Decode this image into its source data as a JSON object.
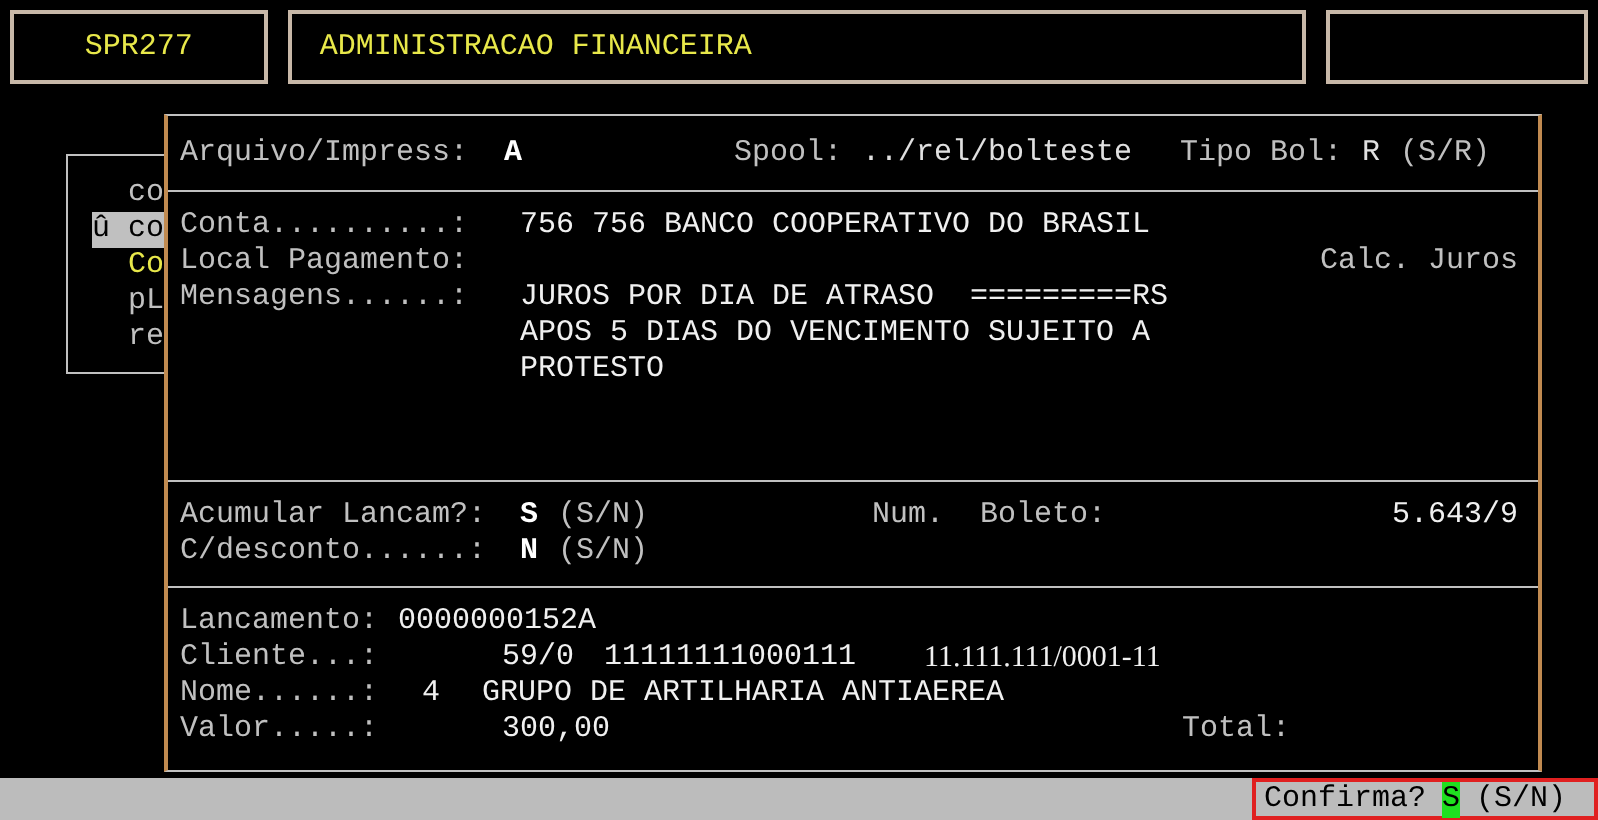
{
  "header": {
    "program_code": "SPR277",
    "module_title": "ADMINISTRACAO FINANCEIRA"
  },
  "background_menu": [
    {
      "text": "co",
      "selected": false,
      "highlighted": false
    },
    {
      "text": "û co",
      "selected": true,
      "highlighted": false
    },
    {
      "text": "Co",
      "selected": false,
      "highlighted": true
    },
    {
      "text": "pL",
      "selected": false,
      "highlighted": false
    },
    {
      "text": "re",
      "selected": false,
      "highlighted": false
    }
  ],
  "dialog": {
    "print_row": [
      {
        "label": "Arquivo/Impress:",
        "value": "A"
      },
      {
        "label": "Spool:",
        "value": "../rel/bolteste"
      },
      {
        "label": "Tipo Bol:",
        "value": "R",
        "hint": "(S/R)"
      }
    ],
    "account": {
      "label": "Conta..........:",
      "value": "756 756 BANCO COOPERATIVO DO BRASIL"
    },
    "payment_place": {
      "label": "Local Pagamento:",
      "side_label": "Calc. Juros"
    },
    "messages": {
      "label": "Mensagens......:",
      "lines": [
        "JUROS POR DIA DE ATRASO  =========RS",
        "APOS 5 DIAS DO VENCIMENTO SUJEITO A",
        "PROTESTO"
      ]
    },
    "options": [
      {
        "label": "Acumular Lancam?:",
        "value": "S",
        "hint": "(S/N)"
      },
      {
        "label": "C/desconto......:",
        "value": "N",
        "hint": "(S/N)"
      }
    ],
    "boleto": {
      "label": "Num.  Boleto:",
      "value": "5.643/9"
    },
    "entry": {
      "lancamento": {
        "label": "Lancamento:",
        "value": "0000000152A"
      },
      "cliente": {
        "label": "Cliente...:",
        "code": "59/0",
        "document": "11111111000111",
        "cnpj": "11.111.111/0001-11"
      },
      "nome": {
        "label": "Nome......:",
        "code": "4",
        "value": "GRUPO DE ARTILHARIA ANTIAEREA"
      },
      "valor": {
        "label": "Valor.....:",
        "value": "300,00"
      },
      "total": {
        "label": "Total:"
      }
    }
  },
  "status_bar": {
    "prompt": "Confirma?",
    "answer": "S",
    "hint": "(S/N)"
  }
}
